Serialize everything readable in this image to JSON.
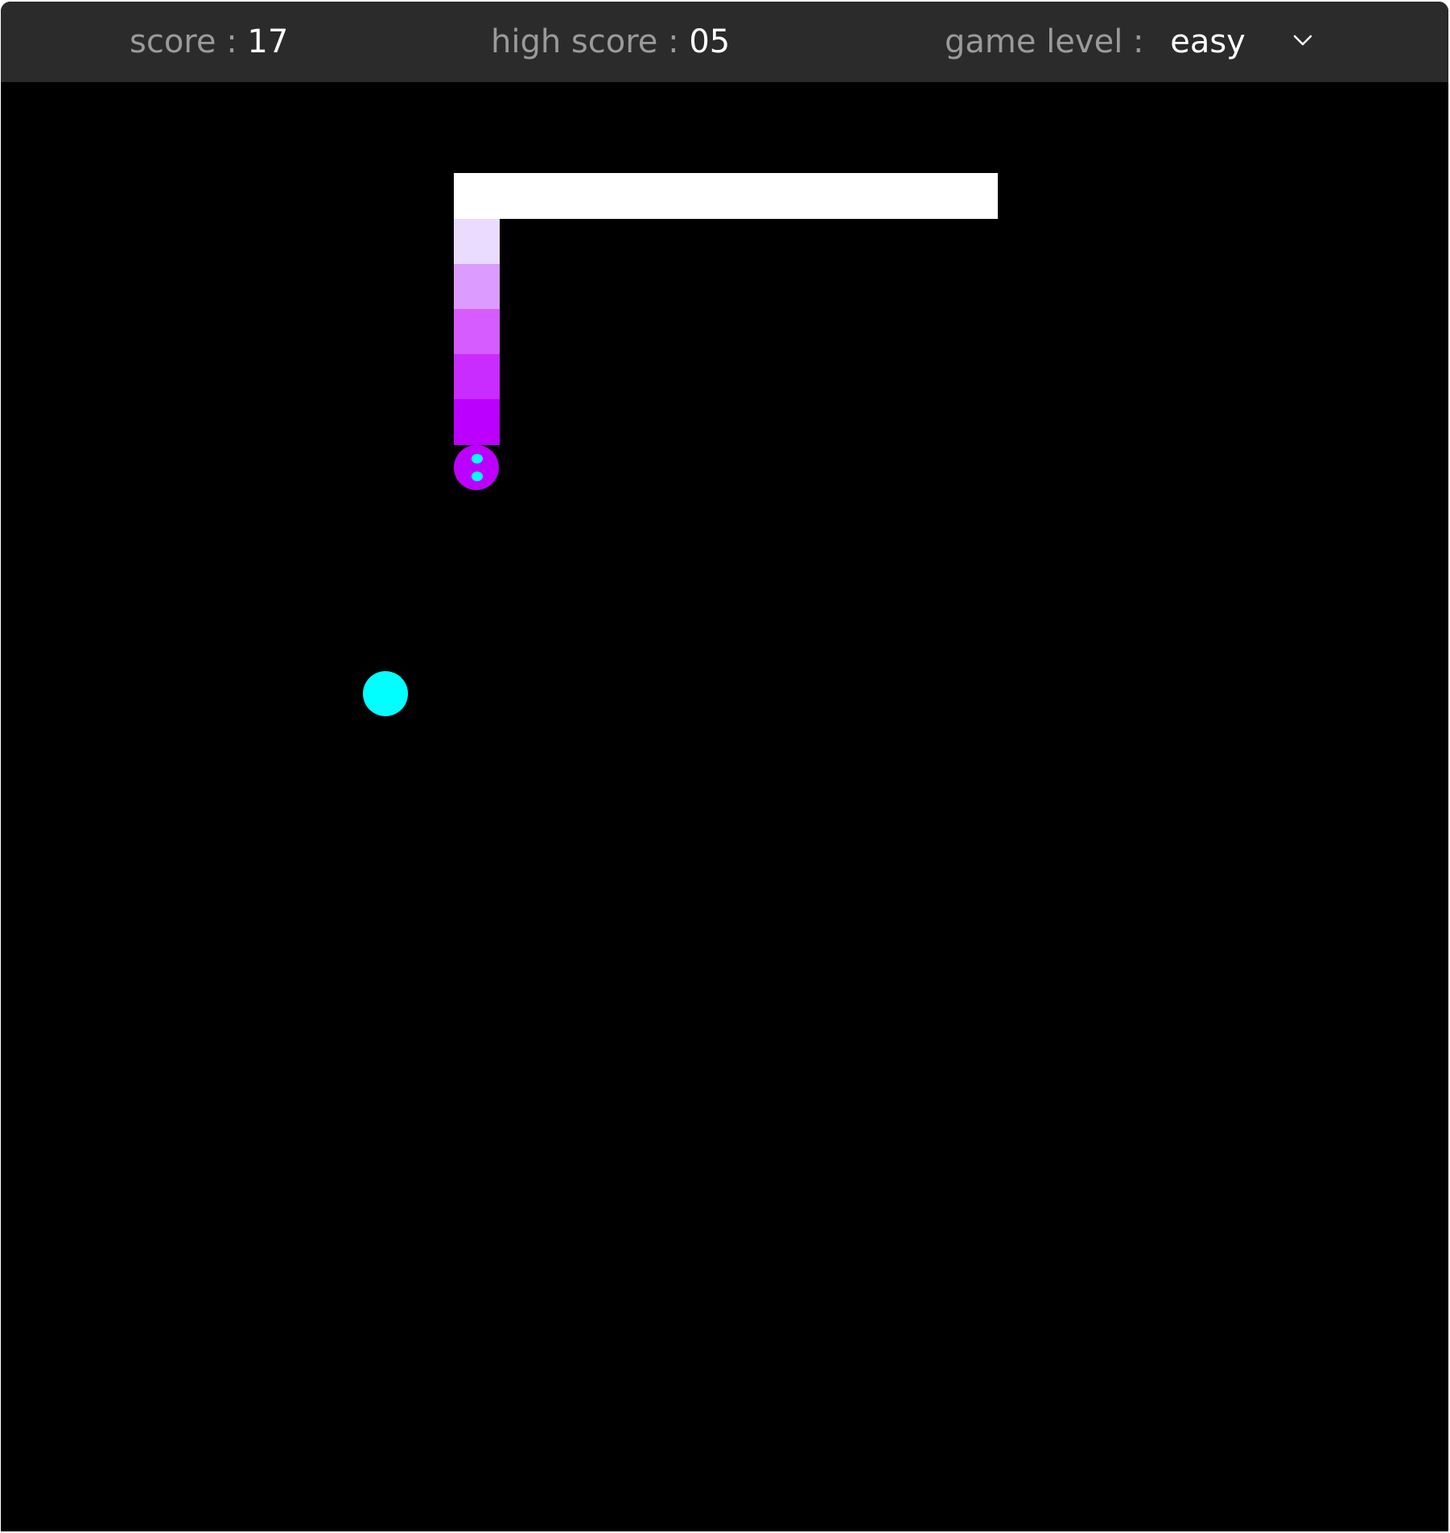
{
  "header": {
    "score_label": "score :",
    "score_value": "17",
    "high_score_label": "high score :",
    "high_score_value": "05",
    "level_label": "game level :",
    "level_value": "easy",
    "dropdown_icon": "chevron-down-icon"
  },
  "colors": {
    "topbar_bg": "#2b2b2b",
    "board_bg": "#000000",
    "label_text": "#9a9a9a",
    "value_text": "#ffffff",
    "wall": "#ffffff",
    "food": "#00ffff",
    "snake_head": "#bb00ff",
    "snake_eyes": "#00ffff",
    "snake_body": [
      "#eadcff",
      "#dc9cff",
      "#d65cff",
      "#c92cff",
      "#bb00ff"
    ]
  }
}
